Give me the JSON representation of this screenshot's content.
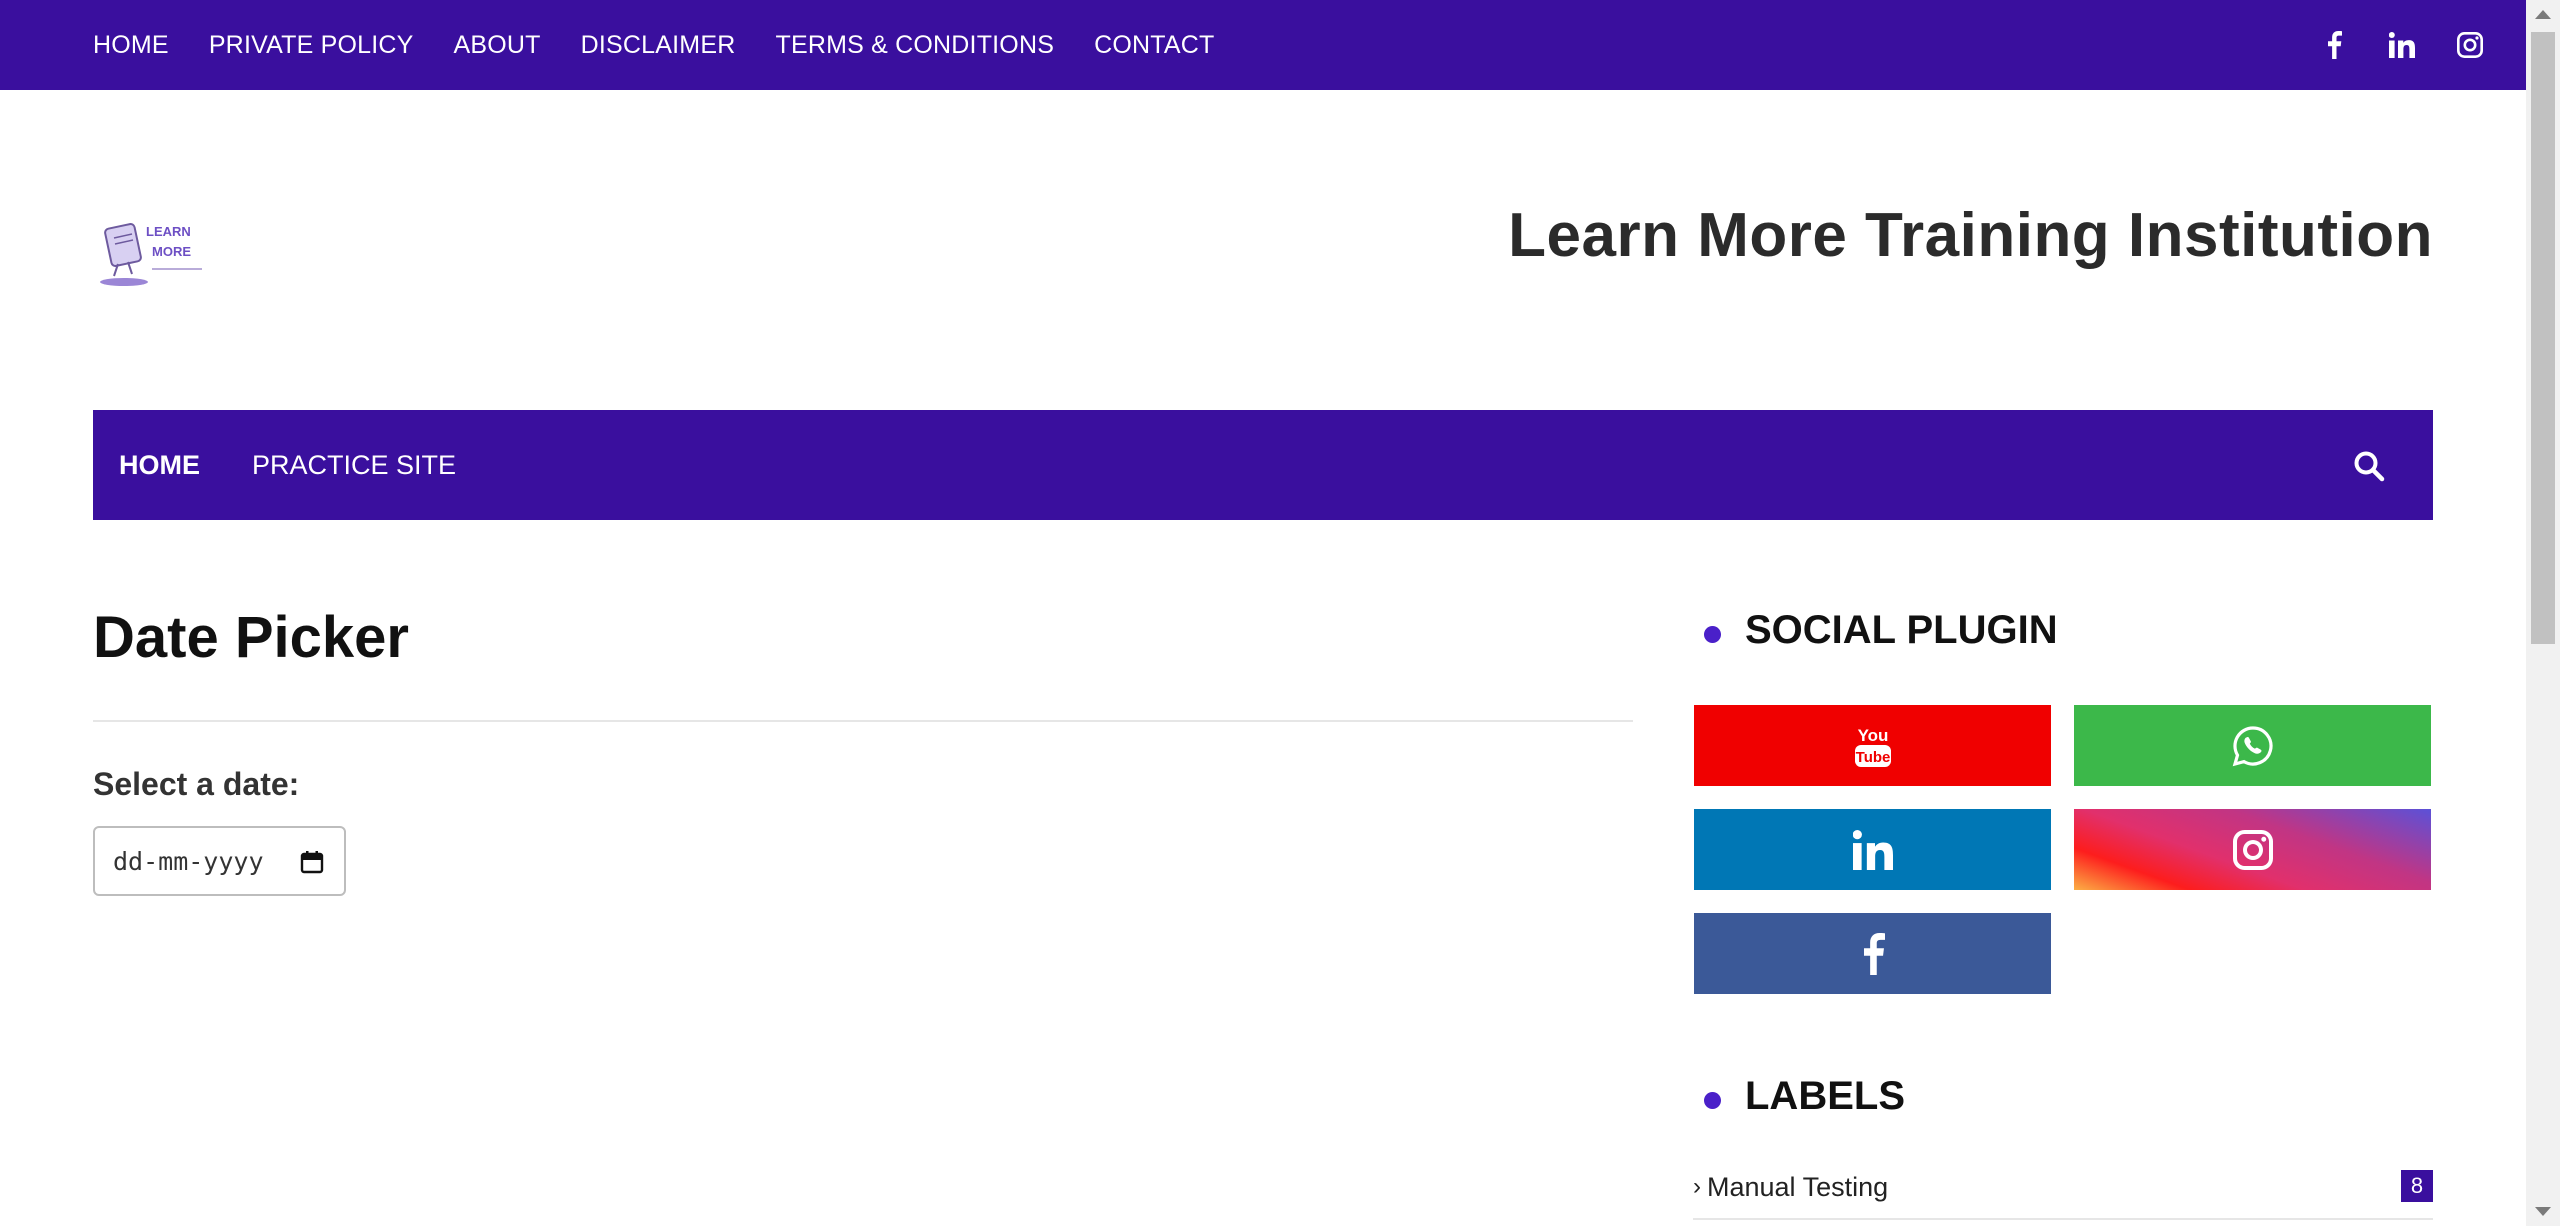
{
  "colors": {
    "brand": "#3a0f9e",
    "accent_dot": "#4a20c9",
    "youtube": "#f00000",
    "whatsapp": "#3cb84a",
    "linkedin": "#0077b5",
    "facebook": "#3b5998"
  },
  "topnav": {
    "items": [
      "HOME",
      "PRIVATE POLICY",
      "ABOUT",
      "DISCLAIMER",
      "TERMS & CONDITIONS",
      "CONTACT"
    ],
    "social_icons": [
      "facebook-icon",
      "linkedin-icon",
      "instagram-icon"
    ]
  },
  "header": {
    "logo_text_line1": "LEARN",
    "logo_text_line2": "MORE",
    "site_title": "Learn More Training Institution"
  },
  "mainnav": {
    "items": [
      "HOME",
      "PRACTICE SITE"
    ],
    "search_icon": "search-icon"
  },
  "post": {
    "title": "Date Picker",
    "field_label": "Select a date:",
    "date_placeholder": "dd-mm-yyyy"
  },
  "sidebar": {
    "social_title": "SOCIAL PLUGIN",
    "social_buttons": [
      "youtube",
      "whatsapp",
      "linkedin",
      "instagram",
      "facebook"
    ],
    "labels_title": "LABELS",
    "labels": [
      {
        "name": "Manual Testing",
        "count": "8"
      }
    ]
  }
}
